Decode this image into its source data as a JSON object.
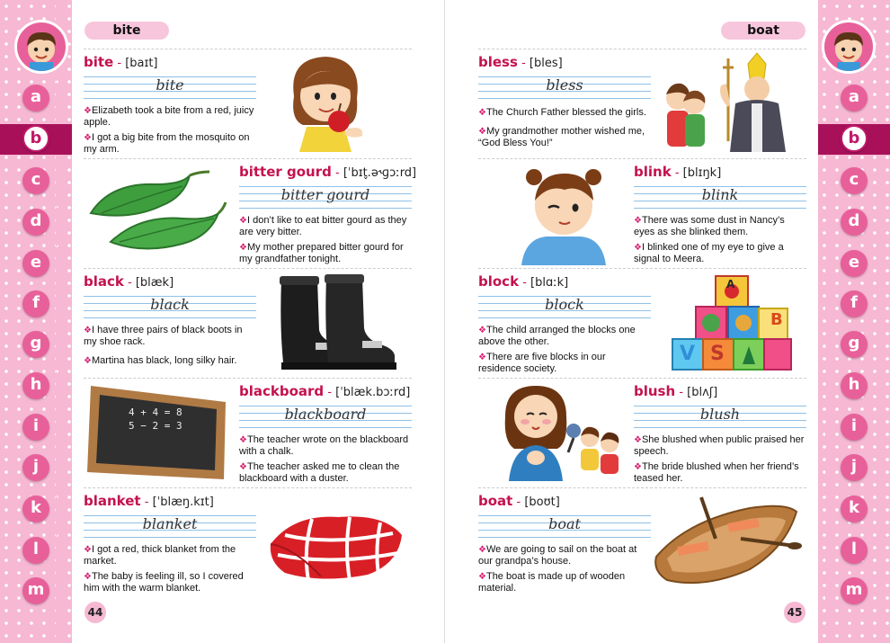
{
  "left_page": {
    "guide_word": "bite",
    "page_number": "44",
    "entries": [
      {
        "word": "bite",
        "pron": "[baɪt]",
        "cursive": "bite",
        "sentences": [
          "Elizabeth took a bite from a red, juicy apple.",
          "I got a big bite from the mosquito on my arm."
        ],
        "image": "girl-biting-apple"
      },
      {
        "word": "bitter gourd",
        "pron": "[ˈbɪt̬.ə˞ɡɔːrd]",
        "cursive": "bitter gourd",
        "sentences": [
          "I don’t like to eat bitter gourd as they are very bitter.",
          "My mother prepared bitter gourd for my grandfather tonight."
        ],
        "image": "bitter-gourds"
      },
      {
        "word": "black",
        "pron": "[blæk]",
        "cursive": "black",
        "sentences": [
          "I have three pairs of black boots in my shoe rack.",
          "Martina has black, long silky hair."
        ],
        "image": "black-boots"
      },
      {
        "word": "blackboard",
        "pron": "[ˈblæk.bɔːrd]",
        "cursive": "blackboard",
        "sentences": [
          "The teacher wrote on the blackboard with a chalk.",
          "The teacher asked me to clean the blackboard with a duster."
        ],
        "image": "blackboard",
        "board_lines": [
          "4 + 4 = 8",
          "5 − 2 = 3"
        ]
      },
      {
        "word": "blanket",
        "pron": "[ˈblæŋ.kɪt]",
        "cursive": "blanket",
        "sentences": [
          "I got a red, thick blanket from the market.",
          "The baby is feeling ill, so I covered him with the warm blanket."
        ],
        "image": "red-blanket"
      }
    ]
  },
  "right_page": {
    "guide_word": "boat",
    "page_number": "45",
    "entries": [
      {
        "word": "bless",
        "pron": "[bles]",
        "cursive": "bless",
        "sentences": [
          "The Church Father blessed the girls.",
          "My grandmother mother wished me, “God Bless You!”"
        ],
        "image": "priest-blessing-girls"
      },
      {
        "word": "blink",
        "pron": "[blɪŋk]",
        "cursive": "blink",
        "sentences": [
          "There was some dust in Nancy’s eyes as she blinked them.",
          "I blinked one of my eye to give a signal to Meera."
        ],
        "image": "girl-blinking"
      },
      {
        "word": "block",
        "pron": "[blɑːk]",
        "cursive": "block",
        "sentences": [
          "The child arranged the blocks one above the other.",
          "There are five blocks in our residence society."
        ],
        "image": "toy-blocks",
        "block_letters": [
          "A",
          "B",
          "V",
          "S"
        ]
      },
      {
        "word": "blush",
        "pron": "[blʌʃ]",
        "cursive": "blush",
        "sentences": [
          "She blushed when public praised her speech.",
          "The bride blushed when her friend’s teased her."
        ],
        "image": "girl-blushing"
      },
      {
        "word": "boat",
        "pron": "[boʊt]",
        "cursive": "boat",
        "sentences": [
          "We are going to sail on the boat at our grandpa’s house.",
          "The boat is made up of wooden material."
        ],
        "image": "rowing-boat"
      }
    ]
  },
  "alphabet": [
    "a",
    "b",
    "c",
    "d",
    "e",
    "f",
    "g",
    "h",
    "i",
    "j",
    "k",
    "l",
    "m"
  ],
  "active_letter": "b",
  "colors": {
    "accent": "#c4124f",
    "side_pink": "#f6b8d3",
    "tab_pink": "#e8609a",
    "band": "#a8115a"
  }
}
